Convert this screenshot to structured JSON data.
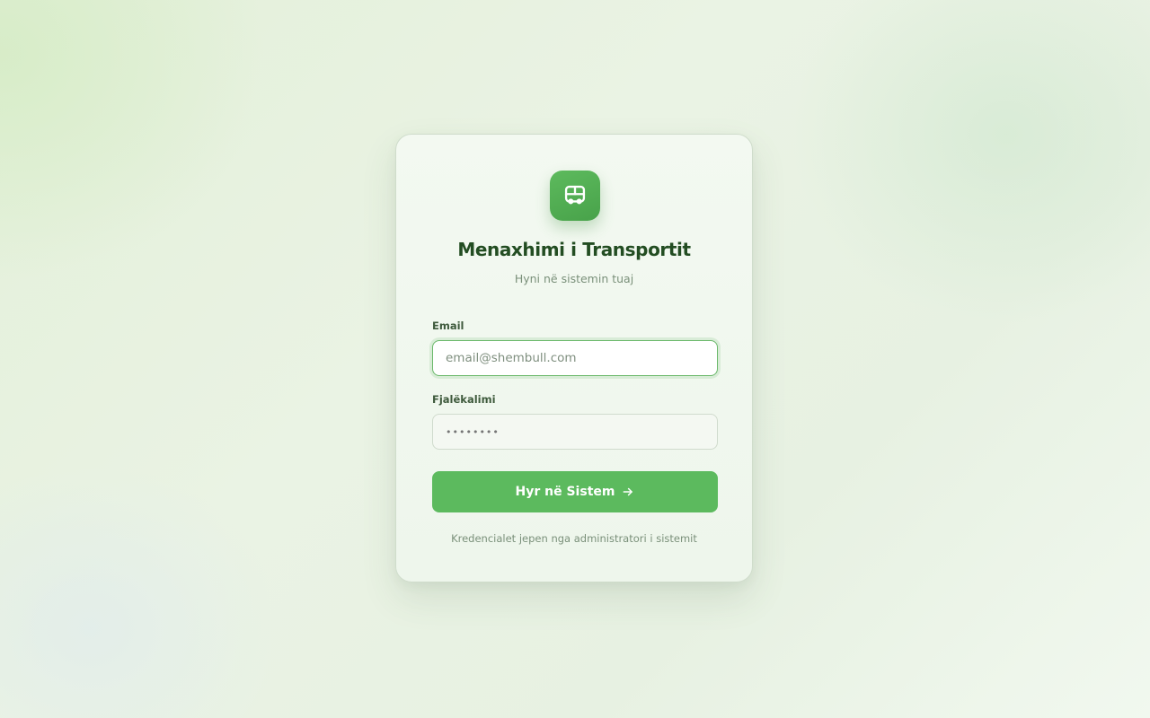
{
  "app": {
    "logo_icon": "bus-icon",
    "title": "Menaxhimi i Transportit",
    "subtitle": "Hyni në sistemin tuaj"
  },
  "form": {
    "email": {
      "label": "Email",
      "value": "",
      "placeholder": "email@shembull.com",
      "state": "focused"
    },
    "password": {
      "label": "Fjalëkalimi",
      "value": "",
      "placeholder": "••••••••"
    },
    "submit": {
      "label": "Hyr në Sistem",
      "icon": "arrow-right-icon"
    },
    "note": "Kredencialet jepen nga administratori i sistemit"
  },
  "colors": {
    "accent": "#5cba5e",
    "title": "#234d22",
    "muted_text": "#7a907a",
    "background": "#e7f1e2"
  }
}
